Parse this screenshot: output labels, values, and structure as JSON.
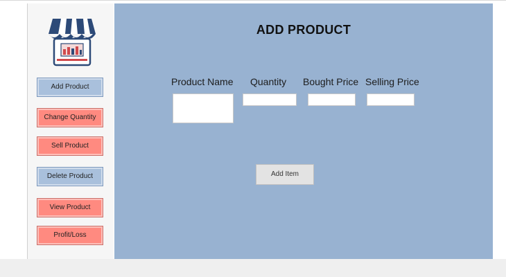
{
  "header": {
    "title": "ADD PRODUCT"
  },
  "sidebar": {
    "logo_icon": "shop-storefront-icon",
    "items": [
      {
        "label": "Add Product",
        "color": "#a9c0dc"
      },
      {
        "label": "Change Quantity",
        "color": "#ff8a80"
      },
      {
        "label": "Sell Product",
        "color": "#ff8a80"
      },
      {
        "label": "Delete Product",
        "color": "#a9c0dc"
      },
      {
        "label": "View Product",
        "color": "#ff8a80"
      },
      {
        "label": "Profit/Loss",
        "color": "#ff8a80"
      }
    ]
  },
  "form": {
    "columns": {
      "product_name": "Product Name",
      "quantity": "Quantity",
      "bought_price": "Bought Price",
      "selling_price": "Selling Price"
    },
    "values": {
      "product_name": "",
      "quantity": "",
      "bought_price": "",
      "selling_price": ""
    },
    "submit_label": "Add Item"
  },
  "colors": {
    "main_background": "#98b2d1",
    "nav_blue": "#a9c0dc",
    "nav_red": "#ff8a80",
    "awning_stripe": "#2d4a78"
  }
}
